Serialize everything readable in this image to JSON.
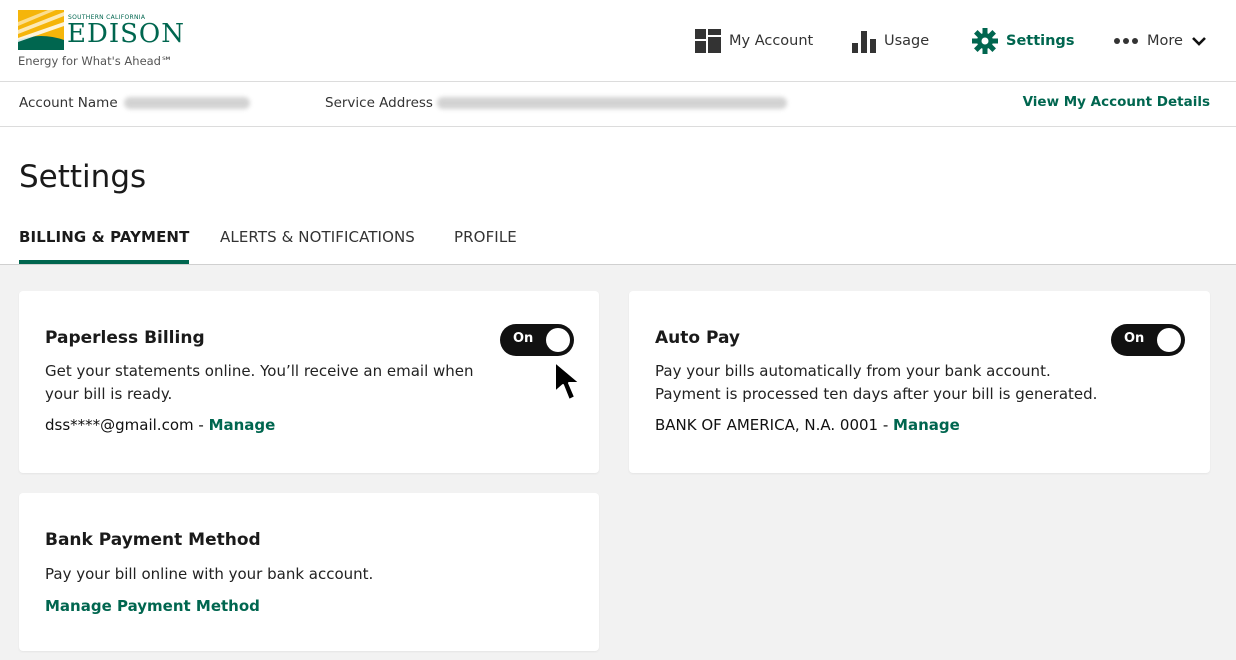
{
  "brand": {
    "small_text": "SOUTHERN CALIFORNIA",
    "name": "EDISON",
    "tagline": "Energy for What's Ahead℠"
  },
  "nav": {
    "items": [
      {
        "label": "My Account",
        "icon": "dashboard-icon"
      },
      {
        "label": "Usage",
        "icon": "bar-chart-icon"
      },
      {
        "label": "Settings",
        "icon": "gear-icon"
      },
      {
        "label": "More",
        "icon": "more-dots-icon"
      }
    ]
  },
  "account_bar": {
    "account_name_label": "Account Name",
    "service_address_label": "Service Address",
    "view_details_link": "View My Account Details"
  },
  "page": {
    "title": "Settings",
    "tabs": [
      {
        "label": "BILLING & PAYMENT",
        "active": true
      },
      {
        "label": "ALERTS & NOTIFICATIONS",
        "active": false
      },
      {
        "label": "PROFILE",
        "active": false
      }
    ]
  },
  "cards": {
    "paperless": {
      "title": "Paperless Billing",
      "description": "Get your statements online. You’ll receive an email when your bill is ready.",
      "detail": "dss****@gmail.com - ",
      "link": "Manage",
      "toggle": "On"
    },
    "autopay": {
      "title": "Auto Pay",
      "description_line1": "Pay your bills automatically from your bank account.",
      "description_line2": "Payment is processed ten days after your bill is generated.",
      "detail": "BANK OF AMERICA, N.A. 0001 - ",
      "link": "Manage",
      "toggle": "On"
    },
    "bank": {
      "title": "Bank Payment Method",
      "description": "Pay your bill online with your bank account.",
      "link": "Manage Payment Method"
    }
  },
  "colors": {
    "brand_green": "#00664f",
    "logo_yellow": "#f5b50a",
    "toggle_on": "#111111"
  }
}
